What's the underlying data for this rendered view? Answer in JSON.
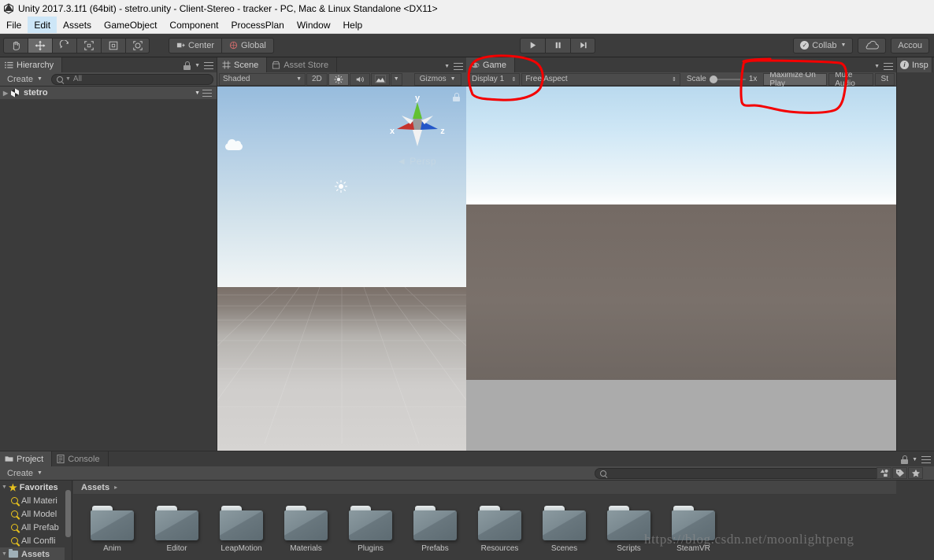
{
  "window": {
    "title": "Unity 2017.3.1f1 (64bit) - stetro.unity - Client-Stereo - tracker - PC, Mac & Linux Standalone <DX11>",
    "logo_icon": "unity-logo-icon"
  },
  "menubar": {
    "items": [
      {
        "label": "File",
        "active": false
      },
      {
        "label": "Edit",
        "active": true
      },
      {
        "label": "Assets",
        "active": false
      },
      {
        "label": "GameObject",
        "active": false
      },
      {
        "label": "Component",
        "active": false
      },
      {
        "label": "ProcessPlan",
        "active": false
      },
      {
        "label": "Window",
        "active": false
      },
      {
        "label": "Help",
        "active": false
      }
    ]
  },
  "toolbar": {
    "transform_tools": [
      {
        "name": "hand-tool",
        "icon": "hand-icon",
        "selected": false
      },
      {
        "name": "move-tool",
        "icon": "move-arrows-icon",
        "selected": true
      },
      {
        "name": "rotate-tool",
        "icon": "rotate-icon",
        "selected": false
      },
      {
        "name": "scale-tool",
        "icon": "scale-icon",
        "selected": false
      },
      {
        "name": "rect-tool",
        "icon": "rect-transform-icon",
        "selected": false
      },
      {
        "name": "transform-tool",
        "icon": "combined-transform-icon",
        "selected": false
      }
    ],
    "pivot_label": "Center",
    "pivot_icon": "pivot-center-icon",
    "space_label": "Global",
    "space_icon": "globe-icon",
    "play_label": "play-icon",
    "pause_label": "pause-icon",
    "step_label": "step-icon",
    "collab_label": "Collab",
    "collab_check_icon": "check-icon",
    "cloud_icon": "cloud-icon",
    "account_label": "Accou"
  },
  "hierarchy": {
    "tab_label": "Hierarchy",
    "tab_icon": "hierarchy-icon",
    "create_label": "Create",
    "search_placeholder": "All",
    "search_icon": "search-icon",
    "lock_icon": "lock-icon",
    "menu_icon": "panel-menu-icon",
    "scene_row": {
      "label": "stetro",
      "icon": "unity-scene-icon",
      "expand_icon": "chevron-right-icon"
    }
  },
  "scene_panel": {
    "tabs": [
      {
        "label": "Scene",
        "icon": "scene-grid-icon",
        "selected": true
      },
      {
        "label": "Asset Store",
        "icon": "asset-store-icon",
        "selected": false
      }
    ],
    "menu_icon": "panel-menu-icon",
    "toolbar": {
      "draw_mode": "Shaded",
      "two_d_label": "2D",
      "lighting_icon": "sun-icon",
      "audio_icon": "speaker-icon",
      "effects_icon": "effects-icon",
      "gizmos_label": "Gizmos"
    },
    "viewport": {
      "persp_label": "Persp",
      "persp_arrow": "◄",
      "lock_icon": "scene-lock-icon",
      "axis_x_label": "x",
      "axis_y_label": "y",
      "axis_z_label": "z",
      "axis_x_color": "#c5322c",
      "axis_y_color": "#62c132",
      "axis_z_color": "#2356c8",
      "light_gizmo_icon": "directional-light-gizmo-icon",
      "cloud_icon": "cloud-icon",
      "sky_top_color": "#97bcdd",
      "sky_horizon_color": "#f2f5f5",
      "ground_color": "#7a6f68",
      "plane_color": "#d6d4d2"
    }
  },
  "game_panel": {
    "tabs": [
      {
        "label": "Game",
        "icon": "game-pad-icon",
        "selected": true
      }
    ],
    "menu_icon": "panel-menu-icon",
    "toolbar": {
      "display_label": "Display 1",
      "aspect_label": "Free Aspect",
      "scale_label": "Scale",
      "scale_value": "1x",
      "maximize_label": "Maximize On Play",
      "mute_label": "Mute Audio",
      "stats_label": "St"
    },
    "viewport": {
      "sky_top_color": "#b9d9ee",
      "sky_bottom_color": "#ffffff",
      "mid_color": "#746a64",
      "floor_color": "#ababab"
    }
  },
  "inspector": {
    "tab_label": "Insp",
    "tab_icon": "info-icon"
  },
  "project_panel": {
    "tabs": [
      {
        "label": "Project",
        "icon": "folder-icon",
        "selected": true
      },
      {
        "label": "Console",
        "icon": "console-icon",
        "selected": false
      }
    ],
    "menu_icon": "panel-menu-icon",
    "create_label": "Create",
    "search_placeholder": "",
    "search_icon": "search-icon",
    "filters": [
      {
        "name": "filter-by-type-icon"
      },
      {
        "name": "filter-by-label-icon"
      },
      {
        "name": "filter-favorites-icon"
      }
    ],
    "tree": [
      {
        "label": "Favorites",
        "type": "favorites",
        "icon": "star-icon",
        "indent": 0,
        "selected": false
      },
      {
        "label": "All Materi",
        "type": "saved-search",
        "icon": "magnifier-icon",
        "indent": 1,
        "selected": false
      },
      {
        "label": "All Model",
        "type": "saved-search",
        "icon": "magnifier-icon",
        "indent": 1,
        "selected": false
      },
      {
        "label": "All Prefab",
        "type": "saved-search",
        "icon": "magnifier-icon",
        "indent": 1,
        "selected": false
      },
      {
        "label": "All Confli",
        "type": "saved-search",
        "icon": "magnifier-icon",
        "indent": 1,
        "selected": false
      },
      {
        "label": "Assets",
        "type": "folder",
        "icon": "folder-icon",
        "indent": 0,
        "selected": true
      }
    ],
    "breadcrumb": {
      "label": "Assets",
      "arrow": "▸"
    },
    "folders": [
      {
        "label": "Anim"
      },
      {
        "label": "Editor"
      },
      {
        "label": "LeapMotion"
      },
      {
        "label": "Materials"
      },
      {
        "label": "Plugins"
      },
      {
        "label": "Prefabs"
      },
      {
        "label": "Resources"
      },
      {
        "label": "Scenes"
      },
      {
        "label": "Scripts"
      },
      {
        "label": "SteamVR"
      }
    ]
  },
  "annotations": {
    "color": "#f40000",
    "marks": [
      {
        "name": "game-tab-circle",
        "target": "Game tab"
      },
      {
        "name": "maximize-on-play-circle",
        "target": "Maximize On Play"
      }
    ]
  },
  "watermark": {
    "text": "https://blog.csdn.net/moonlightpeng"
  }
}
